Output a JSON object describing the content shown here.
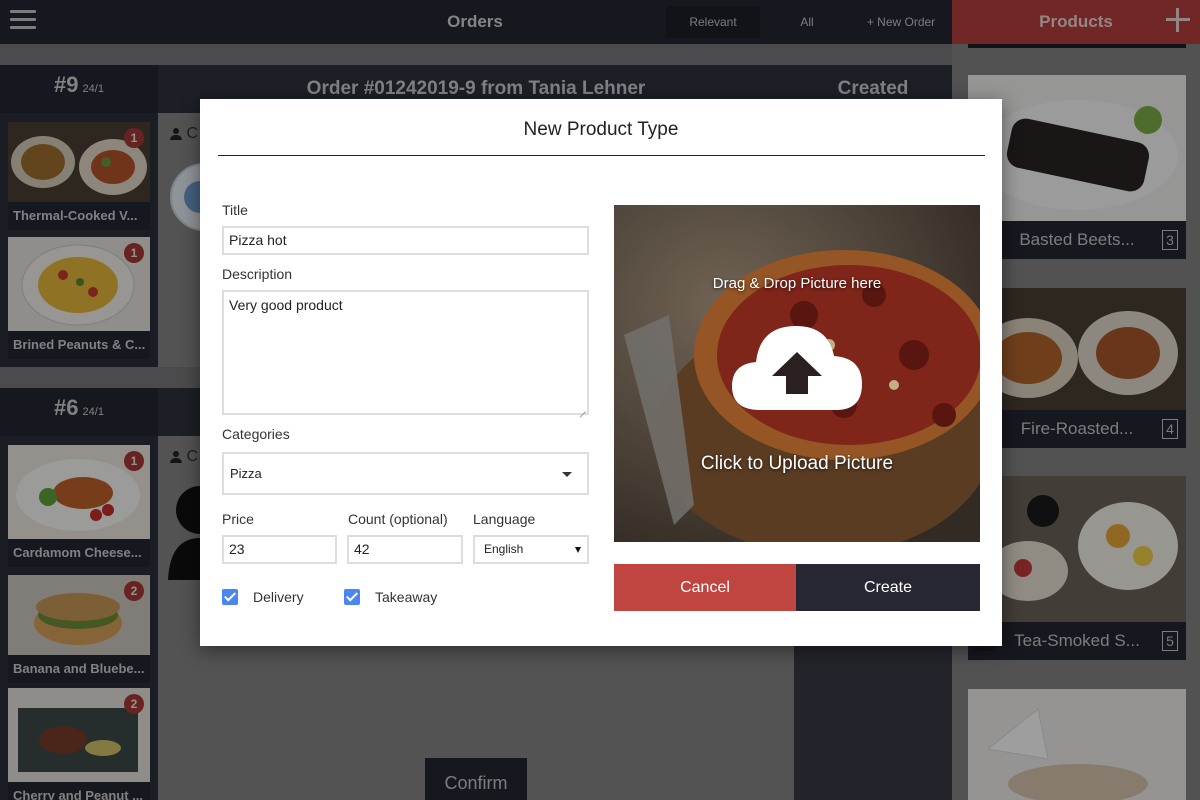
{
  "topbar": {
    "title": "Orders",
    "filters": [
      "Relevant",
      "All",
      "+ New Order"
    ]
  },
  "products_panel": {
    "title": "Products",
    "items": [
      {
        "name": "Basted Beets...",
        "count": "3"
      },
      {
        "name": "Fire-Roasted...",
        "count": "4"
      },
      {
        "name": "Tea-Smoked S...",
        "count": "5"
      }
    ]
  },
  "orders": [
    {
      "number": "#9",
      "date": "24/1",
      "title": "Order #01242019-9 from Tania Lehner",
      "status": "Created",
      "customer_initial": "C",
      "items": [
        {
          "name": "Thermal-Cooked V...",
          "qty": "1"
        },
        {
          "name": "Brined Peanuts & C...",
          "qty": "1"
        }
      ]
    },
    {
      "number": "#6",
      "date": "24/1",
      "customer_initial": "C",
      "items": [
        {
          "name": "Cardamom Cheese...",
          "qty": "1"
        },
        {
          "name": "Banana and Bluebe...",
          "qty": "2"
        },
        {
          "name": "Cherry and Peanut ...",
          "qty": "2"
        }
      ]
    }
  ],
  "confirm_label": "Confirm",
  "modal": {
    "title": "New Product Type",
    "title_label": "Title",
    "title_value": "Pizza hot",
    "description_label": "Description",
    "description_value": "Very good product",
    "categories_label": "Categories",
    "category_value": "Pizza",
    "price_label": "Price",
    "price_value": "23",
    "count_label": "Count (optional)",
    "count_value": "42",
    "language_label": "Language",
    "language_value": "English",
    "delivery_label": "Delivery",
    "delivery_checked": true,
    "takeaway_label": "Takeaway",
    "takeaway_checked": true,
    "upload_drag_text": "Drag & Drop Picture here",
    "upload_click_text": "Click to Upload Picture",
    "cancel_label": "Cancel",
    "create_label": "Create"
  },
  "colors": {
    "dark": "#252733",
    "accent_red": "#c0443f",
    "checkbox_blue": "#4a86f0",
    "badge_red": "#a83838"
  }
}
